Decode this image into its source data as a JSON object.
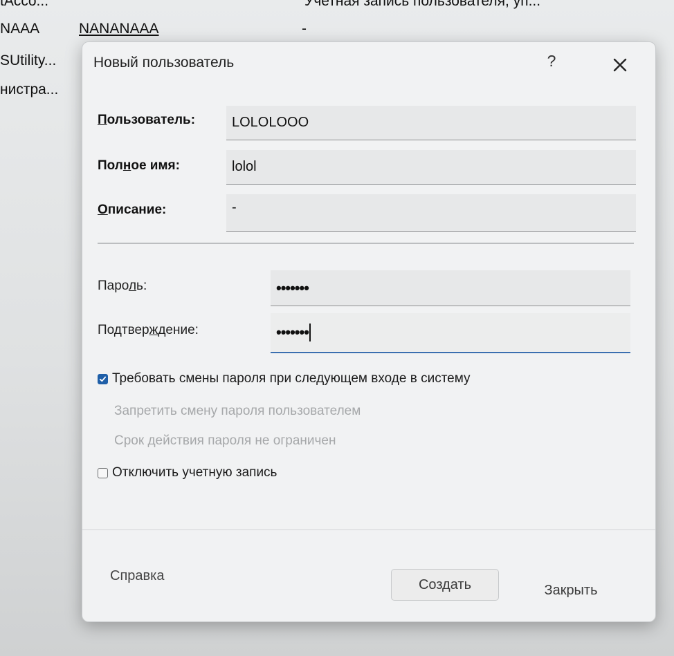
{
  "background": {
    "rows": [
      {
        "col0": "tAcco...",
        "col1": "",
        "col2": "Учетная запись пользователя, уп..."
      },
      {
        "col0": "NAAA",
        "col1": "NANANAAA",
        "col2": "-"
      },
      {
        "col0": "SUtility...",
        "col1": "",
        "col2": ""
      },
      {
        "col0": "нистра...",
        "col1": "",
        "col2": ""
      }
    ]
  },
  "dialog": {
    "title": "Новый пользователь",
    "help_glyph": "?",
    "fields": {
      "user": {
        "label_pre": "",
        "label_ul": "П",
        "label_post": "ользователь:",
        "value": "LOLOLOOO"
      },
      "fullname": {
        "label_pre": "Пол",
        "label_ul": "н",
        "label_post": "ое имя:",
        "value": "lolol"
      },
      "description": {
        "label_pre": "",
        "label_ul": "О",
        "label_post": "писание:",
        "value": "-"
      },
      "password": {
        "label_pre": "Паро",
        "label_ul": "л",
        "label_post": "ь:",
        "value": "•••••••"
      },
      "confirm": {
        "label_pre": "Подтвер",
        "label_ul": "ж",
        "label_post": "дение:",
        "value": "•••••••"
      }
    },
    "checkboxes": [
      {
        "label": "Требовать смены пароля при следующем входе в систему",
        "checked": true,
        "enabled": true
      },
      {
        "label": "Запретить смену пароля пользователем",
        "checked": false,
        "enabled": false
      },
      {
        "label": "Срок действия пароля не ограничен",
        "checked": false,
        "enabled": false
      },
      {
        "label": "Отключить учетную запись",
        "checked": false,
        "enabled": true
      }
    ],
    "buttons": {
      "help": "Справка",
      "create": "Создать",
      "close": "Закрыть"
    }
  },
  "colors": {
    "accent": "#1f5fa8",
    "focus_underline": "#3b6fb0",
    "dialog_bg": "#f1f2f3",
    "disabled_text": "#a6a8aa"
  },
  "icons": {
    "close": "close-icon",
    "check": "check-icon"
  }
}
